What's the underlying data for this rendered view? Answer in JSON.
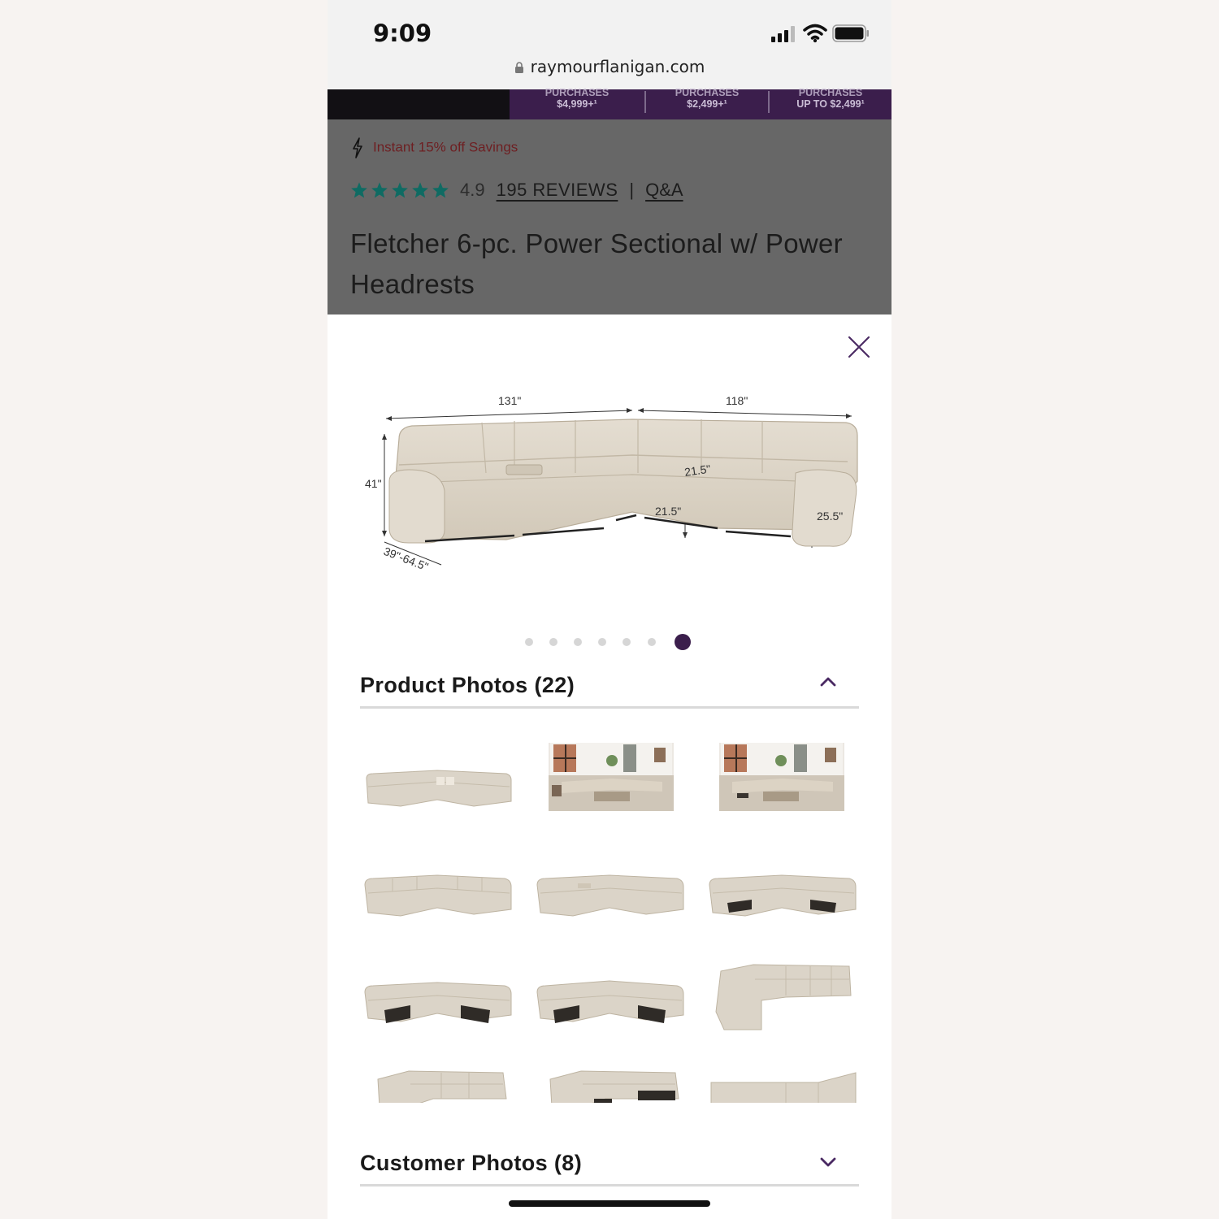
{
  "status_bar": {
    "time": "9:09"
  },
  "browser": {
    "url": "raymourflanigan.com"
  },
  "promo": {
    "cells": [
      {
        "line1": "PURCHASES",
        "line2": "$4,999+¹"
      },
      {
        "line1": "PURCHASES",
        "line2": "$2,499+¹"
      },
      {
        "line1": "PURCHASES",
        "line2": "UP TO $2,499¹"
      }
    ]
  },
  "product": {
    "savings": "Instant 15% off Savings",
    "rating": "4.9",
    "stars": 5,
    "reviews_link": "195 REVIEWS",
    "separator": "|",
    "qa_link": "Q&A",
    "title": "Fletcher 6-pc. Power Sectional w/ Power Headrests"
  },
  "gallery": {
    "dimensions": {
      "width_left": "131\"",
      "width_right": "118\"",
      "height": "41\"",
      "depth": "39\"-64.5\"",
      "seat_depth": "21.5\"",
      "seat_width": "21.5\"",
      "arm_height": "25.5\""
    },
    "dot_count": 7,
    "active_dot": 7
  },
  "sections": {
    "product_photos": "Product Photos (22)",
    "customer_photos": "Customer Photos (8)"
  },
  "colors": {
    "brand_purple": "#3b1e4c",
    "star_teal": "#0f6b63",
    "savings_red": "#6e1f22",
    "sofa_beige": "#d9d1c3"
  }
}
